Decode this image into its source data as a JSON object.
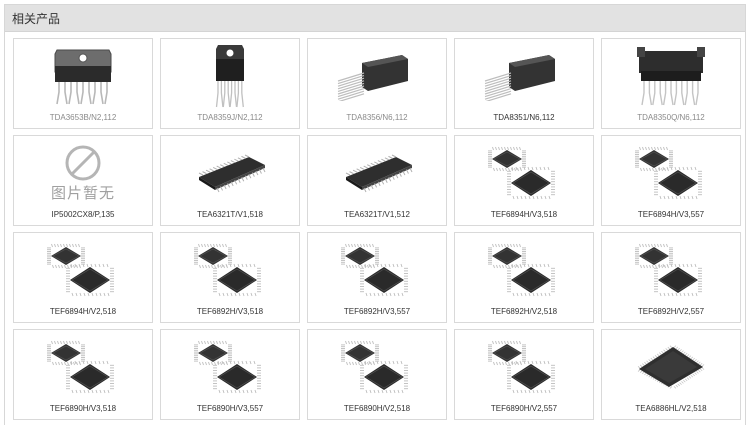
{
  "section": {
    "title": "相关产品"
  },
  "no_image_text": "图片暂无",
  "products": [
    {
      "name": "TDA3653B/N2,112",
      "image": "to220-vertical-icon",
      "muted": true
    },
    {
      "name": "TDA8359J/N2,112",
      "image": "dbs-vertical-icon",
      "muted": true
    },
    {
      "name": "TDA8356/N6,112",
      "image": "sil-horizontal-icon",
      "muted": true
    },
    {
      "name": "TDA8351/N6,112",
      "image": "sil-horizontal-icon",
      "muted": false
    },
    {
      "name": "TDA8350Q/N6,112",
      "image": "dbs-wide-icon",
      "muted": true
    },
    {
      "name": "IP5002CX8/P,135",
      "image": "no-image-icon",
      "muted": false
    },
    {
      "name": "TEA6321T/V1,518",
      "image": "so-package-icon",
      "muted": false
    },
    {
      "name": "TEA6321T/V1,512",
      "image": "so-package-icon",
      "muted": false
    },
    {
      "name": "TEF6894H/V3,518",
      "image": "qfp-pair-icon",
      "muted": false
    },
    {
      "name": "TEF6894H/V3,557",
      "image": "qfp-pair-icon",
      "muted": false
    },
    {
      "name": "TEF6894H/V2,518",
      "image": "qfp-pair-icon",
      "muted": false
    },
    {
      "name": "TEF6892H/V3,518",
      "image": "qfp-pair-icon",
      "muted": false
    },
    {
      "name": "TEF6892H/V3,557",
      "image": "qfp-pair-icon",
      "muted": false
    },
    {
      "name": "TEF6892H/V2,518",
      "image": "qfp-pair-icon",
      "muted": false
    },
    {
      "name": "TEF6892H/V2,557",
      "image": "qfp-pair-icon",
      "muted": false
    },
    {
      "name": "TEF6890H/V3,518",
      "image": "qfp-pair-icon",
      "muted": false
    },
    {
      "name": "TEF6890H/V3,557",
      "image": "qfp-pair-icon",
      "muted": false
    },
    {
      "name": "TEF6890H/V2,518",
      "image": "qfp-pair-icon",
      "muted": false
    },
    {
      "name": "TEF6890H/V2,557",
      "image": "qfp-pair-icon",
      "muted": false
    },
    {
      "name": "TEA6886HL/V2,518",
      "image": "lqfp-single-icon",
      "muted": false
    }
  ],
  "colors": {
    "header_bg": "#e2e2e2",
    "border": "#d9d9d9",
    "label_text": "#333333",
    "label_muted": "#8a8a8a",
    "chip_body": "#2e2e2e"
  }
}
